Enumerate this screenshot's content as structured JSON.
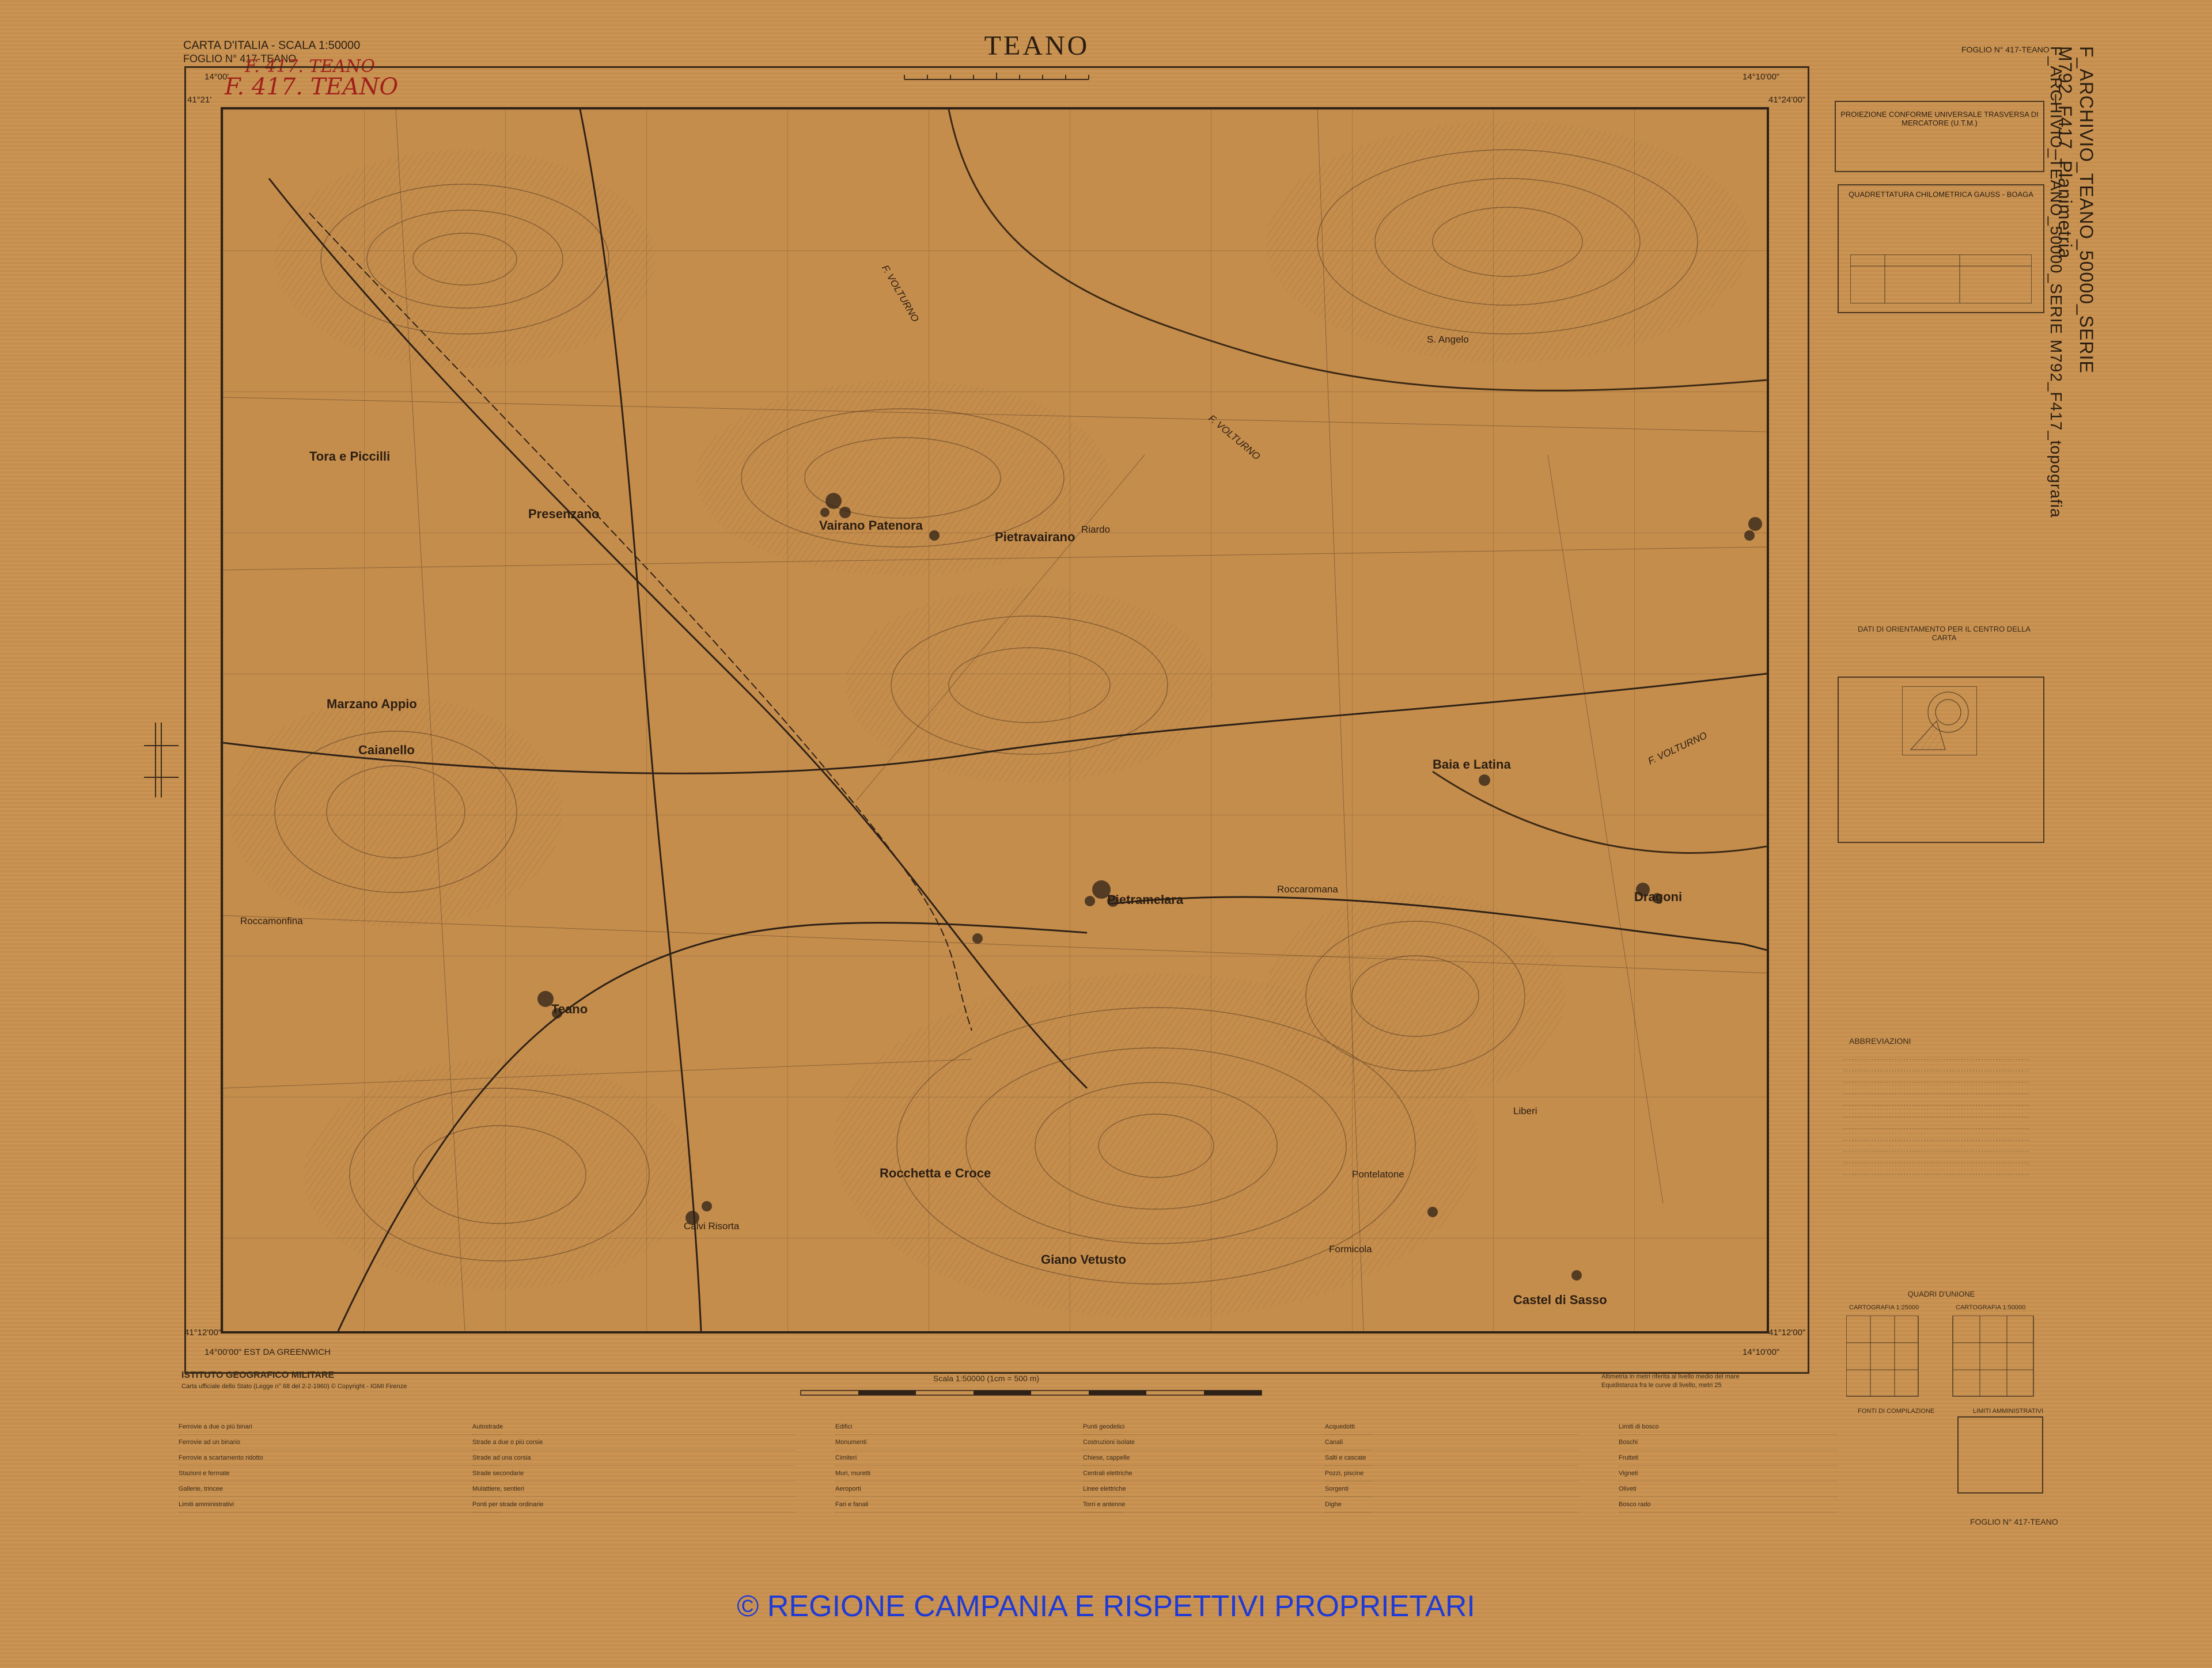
{
  "header": {
    "series": "CARTA D'ITALIA - SCALA 1:50000",
    "sheet": "FOGLIO N° 417-TEANO",
    "title": "TEANO",
    "sheet_right": "FOGLIO N° 417-TEANO",
    "sheet_bottom_right": "FOGLIO N° 417-TEANO",
    "handwritten_1": "F. 417. TEANO",
    "handwritten_2": "F. 417. TEANO"
  },
  "archive_label": "F_ARCHIVIO_TEANO_50000_SERIE M792_F417_Planimetria",
  "archive_label_2": "F_ARCHIVIO_TEANO_50000_SERIE M792_F417_topografia",
  "coordinates": {
    "top_left": "14°00'",
    "top_right": "14°10'00\"",
    "lat_top_left": "41°21'",
    "lat_top_right": "41°24'00\"",
    "bottom_left": "14°00'00\" EST DA GREENWICH",
    "bottom_right": "14°10'00\"",
    "lat_bottom_left": "41°12'00\"",
    "lat_bottom_right": "41°12'00\""
  },
  "map": {
    "places": [
      "Presenzano",
      "Pietravairano",
      "Vairano Patenora",
      "Tora e Piccilli",
      "Marzano Appio",
      "Caianello",
      "S. Angelo",
      "Baia e Latina",
      "Riardo",
      "Pietramelara",
      "Roccaromana",
      "Dragoni",
      "Teano",
      "Rocchetta e Croce",
      "Formicola",
      "Calvi Risorta",
      "Giano Vetusto",
      "Castel di Sasso",
      "Liberi",
      "Pontelatone",
      "Roccamonfina"
    ],
    "rivers": [
      "F. VOLTURNO",
      "F. VOLTURNO",
      "F. VOLTURNO"
    ]
  },
  "right_panels": {
    "projection_title": "PROIEZIONE CONFORME UNIVERSALE TRASVERSA DI MERCATORE (U.T.M.)",
    "grid_title": "QUADRETTATURA CHILOMETRICA GAUSS - BOAGA",
    "orientation_title": "DATI DI ORIENTAMENTO PER IL CENTRO DELLA CARTA",
    "abbreviations_title": "ABBREVIAZIONI",
    "union_title": "QUADRI D'UNIONE",
    "union_left": "CARTOGRAFIA 1:25000",
    "union_right": "CARTOGRAFIA 1:50000",
    "limits_title": "LIMITI AMMINISTRATIVI",
    "compilation_title": "FONTI DI COMPILAZIONE"
  },
  "footer": {
    "institute": "ISTITUTO GEOGRAFICO MILITARE",
    "official_note": "Carta ufficiale dello Stato (Legge n° 68 del 2-2-1960) © Copyright - IGMI Firenze",
    "scale": "Scala 1:50000 (1cm = 500 m)",
    "altimetry_note": "Altimetria in metri riferita al livello medio del mare",
    "equidistance_note": "Equidistanza fra le curve di livello, metri 25"
  },
  "legend": [
    [
      "Ferrovie a due o più binari",
      "Ferrovie ad un binario",
      "Ferrovie a scartamento ridotto",
      "Stazioni e fermate",
      "Gallerie, trincee",
      "Limiti amministrativi"
    ],
    [
      "Autostrade",
      "Strade a due o più corsie",
      "Strade ad una corsia",
      "Strade secondarie",
      "Mulattiere, sentieri",
      "Ponti per strade ordinarie"
    ],
    [
      "Edifici",
      "Monumenti",
      "Cimiteri",
      "Muri, muretti",
      "Aeroporti",
      "Fari e fanali"
    ],
    [
      "Punti geodetici",
      "Costruzioni isolate",
      "Chiese, cappelle",
      "Centrali elettriche",
      "Linee elettriche",
      "Torri e antenne"
    ],
    [
      "Acquedotti",
      "Canali",
      "Salti e cascate",
      "Pozzi, piscine",
      "Sorgenti",
      "Dighe"
    ],
    [
      "Limiti di bosco",
      "Boschi",
      "Frutteti",
      "Vigneti",
      "Oliveti",
      "Bosco rado"
    ]
  ],
  "copyright": "© REGIONE CAMPANIA E RISPETTIVI PROPRIETARI"
}
